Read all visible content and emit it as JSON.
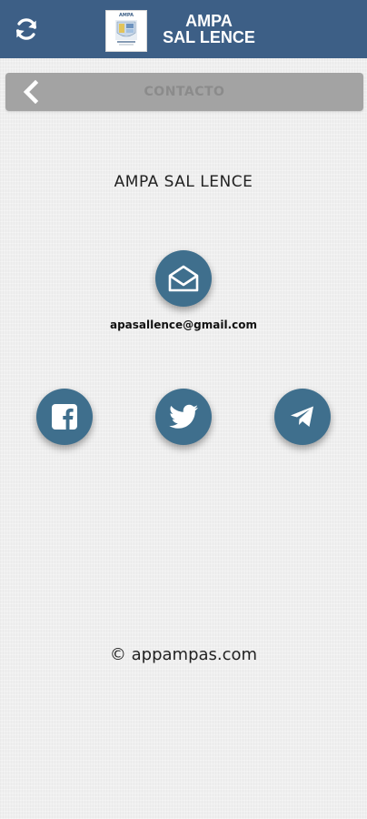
{
  "header": {
    "title_line1": "AMPA",
    "title_line2": "SAL LENCE",
    "logo_text": "AMPA",
    "refresh_icon": "refresh-icon",
    "background_color": "#3d5f86"
  },
  "section": {
    "title": "CONTACTO",
    "back_icon": "chevron-left-icon"
  },
  "contact": {
    "org_name": "AMPA SAL LENCE",
    "email_icon": "envelope-open-icon",
    "email": "apasallence@gmail.com",
    "social": [
      {
        "name": "facebook",
        "icon": "facebook-icon"
      },
      {
        "name": "twitter",
        "icon": "twitter-icon"
      },
      {
        "name": "telegram",
        "icon": "telegram-icon"
      }
    ],
    "button_color": "#3f6f8d"
  },
  "footer": {
    "text": "© appampas.com"
  }
}
